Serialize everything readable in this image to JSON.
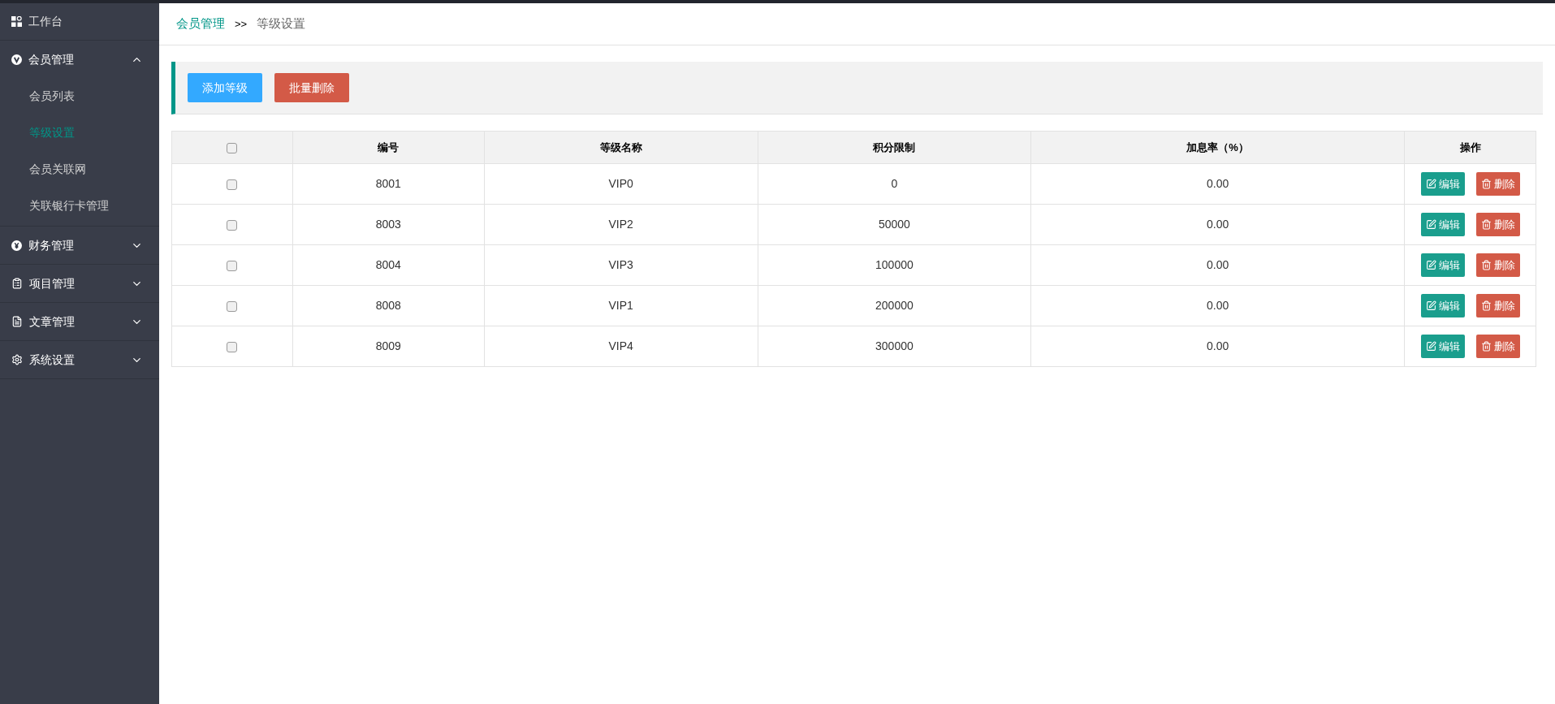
{
  "sidebar": {
    "home": {
      "label": "工作台"
    },
    "groups": [
      {
        "label": "会员管理",
        "expanded": true,
        "children": [
          {
            "label": "会员列表",
            "selected": false
          },
          {
            "label": "等级设置",
            "selected": true
          },
          {
            "label": "会员关联网",
            "selected": false
          },
          {
            "label": "关联银行卡管理",
            "selected": false
          }
        ]
      },
      {
        "label": "财务管理",
        "expanded": false
      },
      {
        "label": "项目管理",
        "expanded": false
      },
      {
        "label": "文章管理",
        "expanded": false
      },
      {
        "label": "系统设置",
        "expanded": false
      }
    ]
  },
  "breadcrumb": {
    "parent": "会员管理",
    "separator": ">>",
    "current": "等级设置"
  },
  "toolbar": {
    "buttons": [
      {
        "label": "添加等级",
        "kind": "primary"
      },
      {
        "label": "批量删除",
        "kind": "danger"
      }
    ]
  },
  "table": {
    "select_all": {
      "checked": false
    },
    "columns": [
      "编号",
      "等级名称",
      "积分限制",
      "加息率（%）",
      "操作"
    ],
    "rows": [
      {
        "checked": false,
        "cells": [
          "8001",
          "VIP0",
          "0",
          "0.00"
        ],
        "actions": [
          "编辑",
          "删除"
        ]
      },
      {
        "checked": false,
        "cells": [
          "8003",
          "VIP2",
          "50000",
          "0.00"
        ],
        "actions": [
          "编辑",
          "删除"
        ]
      },
      {
        "checked": false,
        "cells": [
          "8004",
          "VIP3",
          "100000",
          "0.00"
        ],
        "actions": [
          "编辑",
          "删除"
        ]
      },
      {
        "checked": false,
        "cells": [
          "8008",
          "VIP1",
          "200000",
          "0.00"
        ],
        "actions": [
          "编辑",
          "删除"
        ]
      },
      {
        "checked": false,
        "cells": [
          "8009",
          "VIP4",
          "300000",
          "0.00"
        ],
        "actions": [
          "编辑",
          "删除"
        ]
      }
    ]
  }
}
